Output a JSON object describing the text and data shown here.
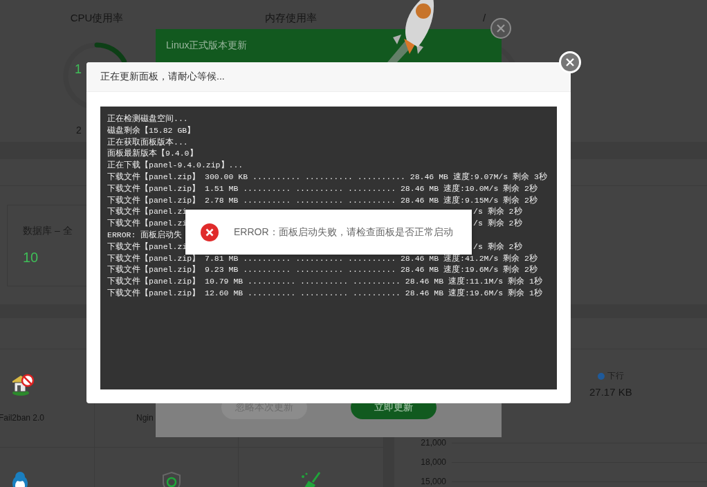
{
  "dashboard": {
    "gauges": [
      {
        "label": "CPU使用率",
        "value": "1",
        "detail": "2",
        "level": 0.17
      },
      {
        "label": "内存使用率"
      },
      {
        "label": "/"
      }
    ],
    "overview_cards": [
      {
        "title": "数据库 – 全",
        "value": "10"
      }
    ],
    "software": [
      {
        "name": "Fail2ban 2.0"
      },
      {
        "name": "Ngin"
      }
    ],
    "traffic": {
      "legend": [
        {
          "label": "下行",
          "color": "#1f5a9a"
        }
      ],
      "value": "27.17 KB",
      "axis_labels": [
        "21,000",
        "18,000",
        "15,000"
      ]
    }
  },
  "update_dialog": {
    "title": "Linux正式版本更新",
    "buttons": [
      {
        "label": "忽略本次更新",
        "kind": "secondary"
      },
      {
        "label": "立即更新",
        "kind": "primary"
      }
    ]
  },
  "progress_dialog": {
    "title": "正在更新面板，请耐心等候...",
    "log": [
      {
        "text": "正在检测磁盘空间..."
      },
      {
        "text": "磁盘剩余【15.82 GB】"
      },
      {
        "text": "正在获取面板版本..."
      },
      {
        "text": "面板最新版本【9.4.0】"
      },
      {
        "text": "正在下载【panel-9.4.0.zip】..."
      },
      {
        "text": "下载文件【panel.zip】 300.00 KB .......... .......... .......... 28.46 MB 速度:9.07M/s 剩余 3秒"
      },
      {
        "text": "下载文件【panel.zip】 1.51 MB .......... .......... .......... 28.46 MB 速度:10.0M/s 剩余 2秒"
      },
      {
        "text": "下载文件【panel.zip】 2.78 MB .......... .......... .......... 28.46 MB 速度:9.15M/s 剩余 2秒"
      },
      {
        "text": "下载文件【panel.zi",
        "tail": "/s 剩余 2秒"
      },
      {
        "text": "下载文件【panel.zi",
        "tail": "/s 剩余 2秒"
      },
      {
        "text": "ERROR: 面板启动失"
      },
      {
        "text": "下载文件【panel.zi",
        "tail": "/s 剩余 2秒"
      },
      {
        "text": "下载文件【panel.zip】 7.81 MB .......... .......... .......... 28.46 MB 速度:41.2M/s 剩余 2秒"
      },
      {
        "text": "下载文件【panel.zip】 9.23 MB .......... .......... .......... 28.46 MB 速度:19.6M/s 剩余 2秒"
      },
      {
        "text": "下载文件【panel.zip】 10.79 MB .......... .......... .......... 28.46 MB 速度:11.1M/s 剩余 1秒"
      },
      {
        "text": "下载文件【panel.zip】 12.60 MB .......... .......... .......... 28.46 MB 速度:19.6M/s 剩余 1秒"
      }
    ]
  },
  "toast": {
    "kind": "error",
    "message": "ERROR：面板启动失败，请检查面板是否正常启动"
  }
}
